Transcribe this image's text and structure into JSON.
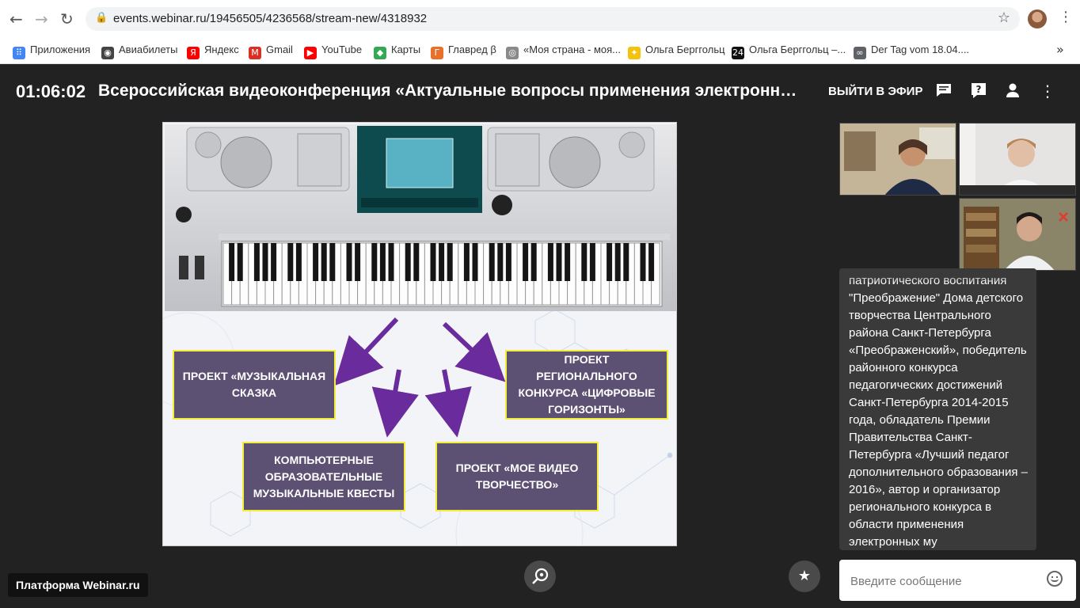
{
  "browser": {
    "url": "events.webinar.ru/19456505/4236568/stream-new/4318932",
    "back_icon": "←",
    "forward_icon": "→",
    "reload_icon": "↻",
    "lock_icon": "🔒",
    "star_icon": "☆",
    "menu_icon": "⋮"
  },
  "bookmarks": {
    "items": [
      {
        "label": "Приложения",
        "icon": "apps-icon",
        "color": "#4285f4",
        "glyph": "⠿"
      },
      {
        "label": "Авиабилеты",
        "icon": "globe-icon",
        "color": "#444444",
        "glyph": "◉"
      },
      {
        "label": "Яндекс",
        "icon": "yandex-icon",
        "color": "#ff0000",
        "glyph": "Я"
      },
      {
        "label": "Gmail",
        "icon": "gmail-icon",
        "color": "#d93025",
        "glyph": "M"
      },
      {
        "label": "YouTube",
        "icon": "youtube-icon",
        "color": "#ff0000",
        "glyph": "▶"
      },
      {
        "label": "Карты",
        "icon": "maps-icon",
        "color": "#34a853",
        "glyph": "◆"
      },
      {
        "label": "Главред β",
        "icon": "glavred-icon",
        "color": "#e8702a",
        "glyph": "Г"
      },
      {
        "label": "«Моя страна - моя...",
        "icon": "site-icon",
        "color": "#8a8a8a",
        "glyph": "◎"
      },
      {
        "label": "Ольга Берггольц",
        "icon": "bulb-icon",
        "color": "#f4c20d",
        "glyph": "✦"
      },
      {
        "label": "Ольга Берггольц –...",
        "icon": "channel-24-icon",
        "color": "#111111",
        "glyph": "24"
      },
      {
        "label": "Der Tag vom 18.04....",
        "icon": "link-icon",
        "color": "#5f6368",
        "glyph": "∞"
      }
    ],
    "more_icon": "»"
  },
  "webinar": {
    "timer": "01:06:02",
    "title": "Всероссийская видеоконференция «Актуальные вопросы применения электронных кла...",
    "go_live": "ВЫЙТИ В ЭФИР",
    "chat_icon": "▬",
    "question_icon": "?",
    "person_icon": "●",
    "more_icon": "⋮"
  },
  "slide": {
    "box1": "ПРОЕКТ «МУЗЫКАЛЬНАЯ СКАЗКА",
    "box2": "ПРОЕКТ РЕГИОНАЛЬНОГО КОНКУРСА «ЦИФРОВЫЕ ГОРИЗОНТЫ»",
    "box3": "КОМПЬЮТЕРНЫЕ ОБРАЗОВАТЕЛЬНЫЕ МУЗЫКАЛЬНЫЕ КВЕСТЫ",
    "box4": "ПРОЕКТ «МОЕ ВИДЕО ТВОРЧЕСТВО»",
    "accent_color": "#f4ee3a",
    "box_color": "#5d5173",
    "arrow_color": "#6a2c9c"
  },
  "sidebar": {
    "bio_text": "патриотического воспитания \"Преображение\" Дома детского творчества Центрального района Санкт-Петербурга «Преображенский», победитель районного конкурса педагогических достижений Санкт-Петербурга 2014-2015 года, обладатель Премии Правительства Санкт-Петербурга «Лучший педагог дополнительного образования – 2016», автор и организатор регионального конкурса в области применения электронных му"
  },
  "footer": {
    "brand": "Платформа Webinar.ru",
    "zoom_icon": "⊕",
    "star_icon": "★",
    "message_placeholder": "Введите сообщение"
  }
}
